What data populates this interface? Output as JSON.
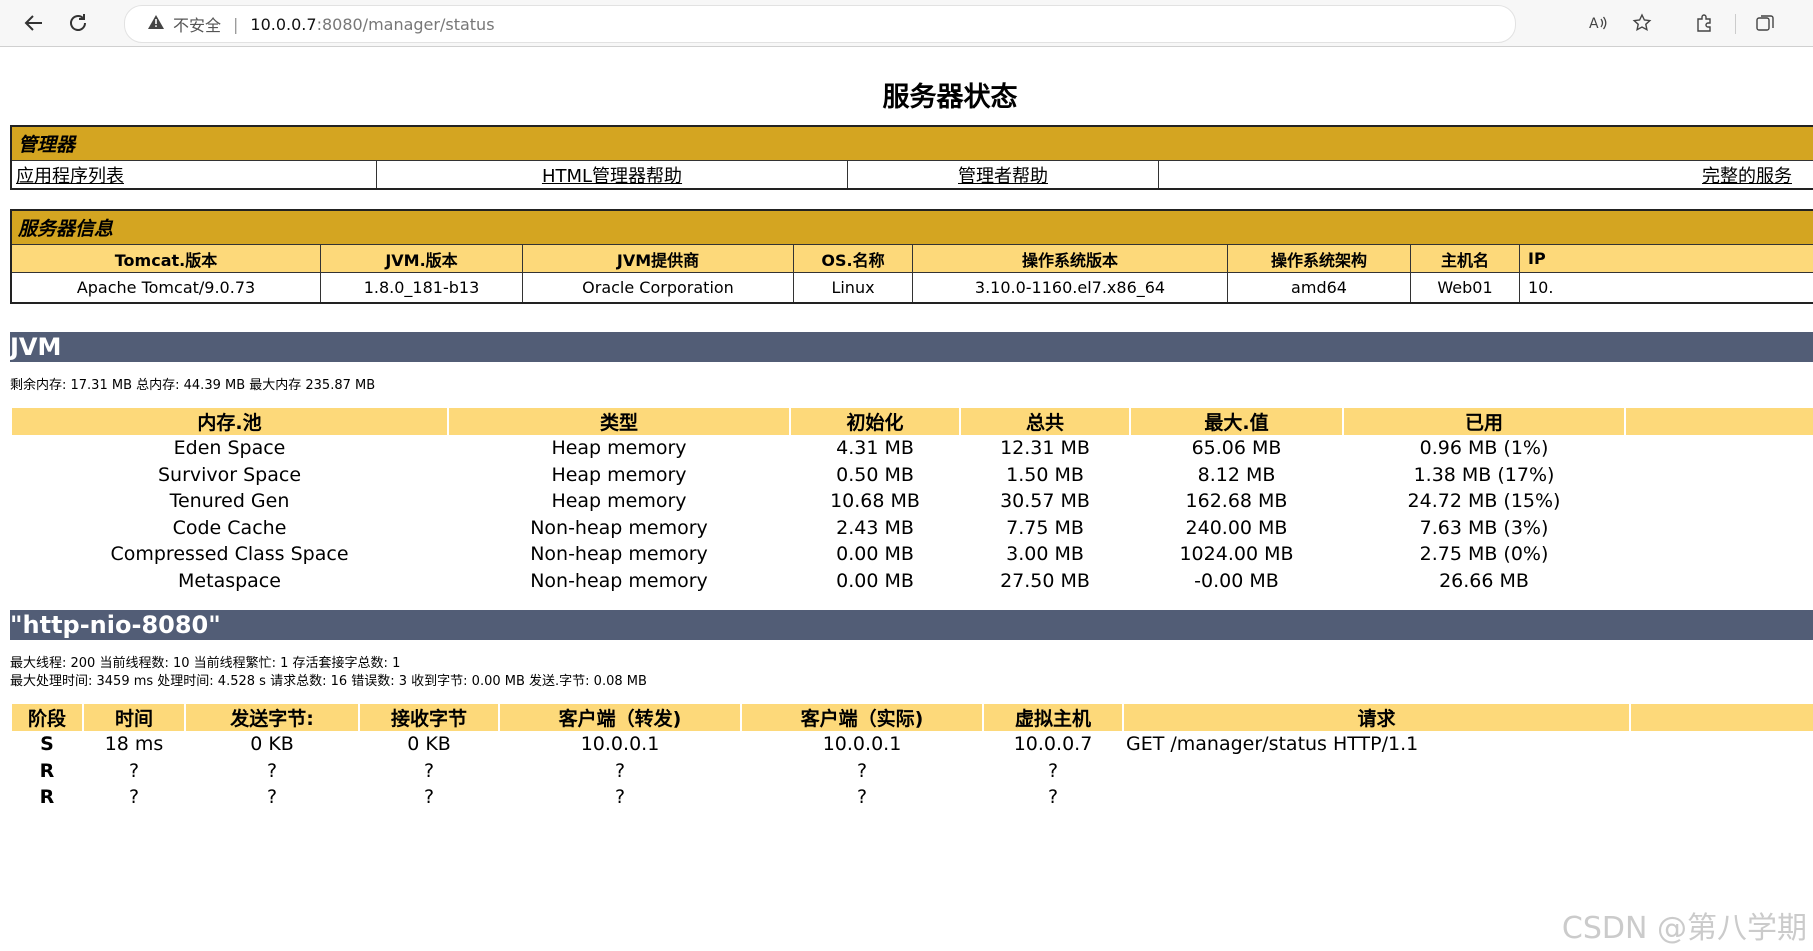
{
  "browser": {
    "back_icon": "back-arrow-icon",
    "refresh_icon": "refresh-icon",
    "security_label": "不安全",
    "url_host": "10.0.0.7",
    "url_path": ":8080/manager/status"
  },
  "page": {
    "title": "服务器状态"
  },
  "manager": {
    "heading": "管理器",
    "links": [
      "应用程序列表",
      "HTML管理器帮助",
      "管理者帮助",
      "完整的服务"
    ]
  },
  "server_info": {
    "heading": "服务器信息",
    "headers": [
      "Tomcat.版本",
      "JVM.版本",
      "JVM提供商",
      "OS.名称",
      "操作系统版本",
      "操作系统架构",
      "主机名",
      "IP"
    ],
    "values": [
      "Apache Tomcat/9.0.73",
      "1.8.0_181-b13",
      "Oracle Corporation",
      "Linux",
      "3.10.0-1160.el7.x86_64",
      "amd64",
      "Web01",
      "10."
    ]
  },
  "jvm": {
    "heading": "JVM",
    "summary": "剩余内存:   17.31 MB 总内存:   44.39 MB 最大内存 235.87 MB",
    "headers": [
      "内存.池",
      "类型",
      "初始化",
      "总共",
      "最大.值",
      "已用"
    ],
    "rows": [
      [
        "Eden Space",
        "Heap memory",
        "4.31 MB",
        "12.31 MB",
        "65.06 MB",
        "0.96 MB (1%)"
      ],
      [
        "Survivor Space",
        "Heap memory",
        "0.50 MB",
        "1.50 MB",
        "8.12 MB",
        "1.38 MB (17%)"
      ],
      [
        "Tenured Gen",
        "Heap memory",
        "10.68 MB",
        "30.57 MB",
        "162.68 MB",
        "24.72 MB (15%)"
      ],
      [
        "Code Cache",
        "Non-heap memory",
        "2.43 MB",
        "7.75 MB",
        "240.00 MB",
        "7.63 MB (3%)"
      ],
      [
        "Compressed Class Space",
        "Non-heap memory",
        "0.00 MB",
        "3.00 MB",
        "1024.00 MB",
        "2.75 MB (0%)"
      ],
      [
        "Metaspace",
        "Non-heap memory",
        "0.00 MB",
        "27.50 MB",
        "-0.00 MB",
        "26.66 MB"
      ]
    ]
  },
  "connector": {
    "heading": "\"http-nio-8080\"",
    "line1": "最大线程:   200 当前线程数:   10 当前线程繁忙:   1 存活套接字总数:   1",
    "line2": "最大处理时间:   3459 ms 处理时间:   4.528 s 请求总数:   16 错误数:   3 收到字节:   0.00 MB 发送.字节: 0.08 MB",
    "headers": [
      "阶段",
      "时间",
      "发送字节:",
      "接收字节",
      "客户端（转发)",
      "客户端（实际)",
      "虚拟主机",
      "请求"
    ],
    "rows": [
      [
        "S",
        "18 ms",
        "0 KB",
        "0 KB",
        "10.0.0.1",
        "10.0.0.1",
        "10.0.0.7",
        "GET /manager/status HTTP/1.1"
      ],
      [
        "R",
        "?",
        "?",
        "?",
        "?",
        "?",
        "?",
        ""
      ],
      [
        "R",
        "?",
        "?",
        "?",
        "?",
        "?",
        "?",
        ""
      ]
    ]
  },
  "watermark": "CSDN @第八学期"
}
